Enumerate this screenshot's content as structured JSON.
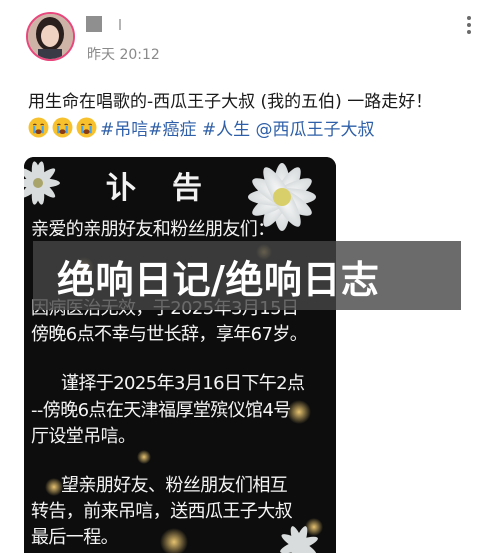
{
  "post": {
    "author_name": "",
    "timestamp": "昨天 20:12",
    "text": "用生命在唱歌的-西瓜王子大叔 (我的五伯) 一路走好！",
    "emoji_icons": [
      "crying-face-icon",
      "crying-face-icon",
      "crying-face-icon"
    ],
    "tags": "#吊唁#癌症 #人生 @西瓜王子大叔"
  },
  "image": {
    "title": "讣告",
    "lines": [
      "亲爱的亲朋好友和粉丝朋友们：",
      "",
      "因病医治无效，于2025年3月15日",
      "傍晚6点不幸与世长辞，享年67岁。",
      "谨择于2025年3月16日下午2点",
      "--傍晚6点在天津福厚堂殡仪馆4号",
      "厅设堂吊唁。",
      "望亲朋好友、粉丝朋友们相互",
      "转告，前来吊唁，送西瓜王子大叔",
      "最后一程。"
    ]
  },
  "overlay": {
    "banner_text": "绝响日记/绝响日志"
  },
  "colors": {
    "link": "#2e5fa8",
    "avatar_ring": "#e8467c",
    "poster_bg": "#0d0d0d",
    "banner_bg": "#464646"
  }
}
